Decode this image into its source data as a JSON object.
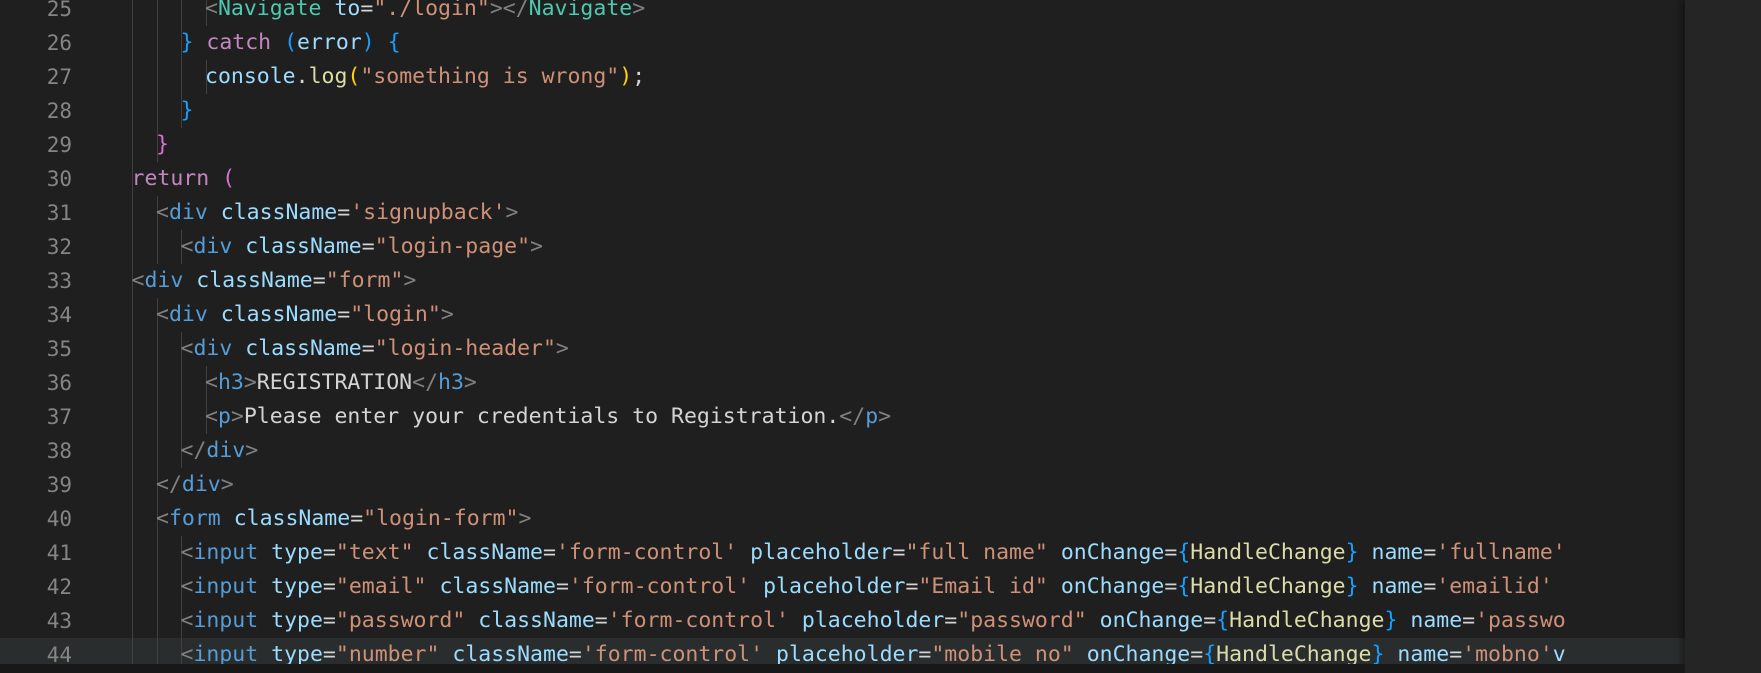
{
  "editor": {
    "lines": [
      {
        "num": "25",
        "indent": 5,
        "tokens": [
          [
            "<",
            "pun"
          ],
          [
            "Navigate",
            "comp"
          ],
          [
            " ",
            "plain"
          ],
          [
            "to",
            "attr"
          ],
          [
            "=",
            "plain"
          ],
          [
            "\"./login\"",
            "str"
          ],
          [
            "></",
            "pun"
          ],
          [
            "Navigate",
            "comp"
          ],
          [
            ">",
            "pun"
          ]
        ]
      },
      {
        "num": "26",
        "indent": 4,
        "tokens": [
          [
            "}",
            "b3"
          ],
          [
            " ",
            "plain"
          ],
          [
            "catch",
            "kw"
          ],
          [
            " ",
            "plain"
          ],
          [
            "(",
            "b3"
          ],
          [
            "error",
            "attr"
          ],
          [
            ")",
            "b3"
          ],
          [
            " ",
            "plain"
          ],
          [
            "{",
            "b3"
          ]
        ]
      },
      {
        "num": "27",
        "indent": 5,
        "tokens": [
          [
            "console",
            "attr"
          ],
          [
            ".",
            "plain"
          ],
          [
            "log",
            "fn"
          ],
          [
            "(",
            "b1"
          ],
          [
            "\"something is wrong\"",
            "str"
          ],
          [
            ")",
            "b1"
          ],
          [
            ";",
            "plain"
          ]
        ]
      },
      {
        "num": "28",
        "indent": 4,
        "tokens": [
          [
            "}",
            "b3"
          ]
        ]
      },
      {
        "num": "29",
        "indent": 3,
        "tokens": [
          [
            "}",
            "b2"
          ]
        ]
      },
      {
        "num": "30",
        "indent": 2,
        "tokens": [
          [
            "return",
            "kw"
          ],
          [
            " ",
            "plain"
          ],
          [
            "(",
            "b2"
          ]
        ]
      },
      {
        "num": "31",
        "indent": 3,
        "tokens": [
          [
            "<",
            "pun"
          ],
          [
            "div",
            "tag"
          ],
          [
            " ",
            "plain"
          ],
          [
            "className",
            "attr"
          ],
          [
            "=",
            "plain"
          ],
          [
            "'signupback'",
            "str"
          ],
          [
            ">",
            "pun"
          ]
        ]
      },
      {
        "num": "32",
        "indent": 4,
        "tokens": [
          [
            "<",
            "pun"
          ],
          [
            "div",
            "tag"
          ],
          [
            " ",
            "plain"
          ],
          [
            "className",
            "attr"
          ],
          [
            "=",
            "plain"
          ],
          [
            "\"login-page\"",
            "str"
          ],
          [
            ">",
            "pun"
          ]
        ]
      },
      {
        "num": "33",
        "indent": 2,
        "tokens": [
          [
            "<",
            "pun"
          ],
          [
            "div",
            "tag"
          ],
          [
            " ",
            "plain"
          ],
          [
            "className",
            "attr"
          ],
          [
            "=",
            "plain"
          ],
          [
            "\"form\"",
            "str"
          ],
          [
            ">",
            "pun"
          ]
        ]
      },
      {
        "num": "34",
        "indent": 3,
        "tokens": [
          [
            "<",
            "pun"
          ],
          [
            "div",
            "tag"
          ],
          [
            " ",
            "plain"
          ],
          [
            "className",
            "attr"
          ],
          [
            "=",
            "plain"
          ],
          [
            "\"login\"",
            "str"
          ],
          [
            ">",
            "pun"
          ]
        ]
      },
      {
        "num": "35",
        "indent": 4,
        "tokens": [
          [
            "<",
            "pun"
          ],
          [
            "div",
            "tag"
          ],
          [
            " ",
            "plain"
          ],
          [
            "className",
            "attr"
          ],
          [
            "=",
            "plain"
          ],
          [
            "\"login-header\"",
            "str"
          ],
          [
            ">",
            "pun"
          ]
        ]
      },
      {
        "num": "36",
        "indent": 5,
        "tokens": [
          [
            "<",
            "pun"
          ],
          [
            "h3",
            "tag"
          ],
          [
            ">",
            "pun"
          ],
          [
            "REGISTRATION",
            "plain"
          ],
          [
            "</",
            "pun"
          ],
          [
            "h3",
            "tag"
          ],
          [
            ">",
            "pun"
          ]
        ]
      },
      {
        "num": "37",
        "indent": 5,
        "tokens": [
          [
            "<",
            "pun"
          ],
          [
            "p",
            "tag"
          ],
          [
            ">",
            "pun"
          ],
          [
            "Please enter your credentials to Registration.",
            "plain"
          ],
          [
            "</",
            "pun"
          ],
          [
            "p",
            "tag"
          ],
          [
            ">",
            "pun"
          ]
        ]
      },
      {
        "num": "38",
        "indent": 4,
        "tokens": [
          [
            "</",
            "pun"
          ],
          [
            "div",
            "tag"
          ],
          [
            ">",
            "pun"
          ]
        ]
      },
      {
        "num": "39",
        "indent": 3,
        "tokens": [
          [
            "</",
            "pun"
          ],
          [
            "div",
            "tag"
          ],
          [
            ">",
            "pun"
          ]
        ]
      },
      {
        "num": "40",
        "indent": 3,
        "tokens": [
          [
            "<",
            "pun"
          ],
          [
            "form",
            "tag"
          ],
          [
            " ",
            "plain"
          ],
          [
            "className",
            "attr"
          ],
          [
            "=",
            "plain"
          ],
          [
            "\"login-form\"",
            "str"
          ],
          [
            ">",
            "pun"
          ]
        ]
      },
      {
        "num": "41",
        "indent": 4,
        "tokens": [
          [
            "<",
            "pun"
          ],
          [
            "input",
            "tag"
          ],
          [
            " ",
            "plain"
          ],
          [
            "type",
            "attr"
          ],
          [
            "=",
            "plain"
          ],
          [
            "\"text\"",
            "str"
          ],
          [
            " ",
            "plain"
          ],
          [
            "className",
            "attr"
          ],
          [
            "=",
            "plain"
          ],
          [
            "'form-control'",
            "str"
          ],
          [
            " ",
            "plain"
          ],
          [
            "placeholder",
            "attr"
          ],
          [
            "=",
            "plain"
          ],
          [
            "\"full name\"",
            "str"
          ],
          [
            " ",
            "plain"
          ],
          [
            "onChange",
            "attr"
          ],
          [
            "=",
            "plain"
          ],
          [
            "{",
            "b3"
          ],
          [
            "HandleChange",
            "fn"
          ],
          [
            "}",
            "b3"
          ],
          [
            " ",
            "plain"
          ],
          [
            "name",
            "attr"
          ],
          [
            "=",
            "plain"
          ],
          [
            "'fullname'",
            "str"
          ]
        ]
      },
      {
        "num": "42",
        "indent": 4,
        "tokens": [
          [
            "<",
            "pun"
          ],
          [
            "input",
            "tag"
          ],
          [
            " ",
            "plain"
          ],
          [
            "type",
            "attr"
          ],
          [
            "=",
            "plain"
          ],
          [
            "\"email\"",
            "str"
          ],
          [
            " ",
            "plain"
          ],
          [
            "className",
            "attr"
          ],
          [
            "=",
            "plain"
          ],
          [
            "'form-control'",
            "str"
          ],
          [
            " ",
            "plain"
          ],
          [
            "placeholder",
            "attr"
          ],
          [
            "=",
            "plain"
          ],
          [
            "\"Email id\"",
            "str"
          ],
          [
            " ",
            "plain"
          ],
          [
            "onChange",
            "attr"
          ],
          [
            "=",
            "plain"
          ],
          [
            "{",
            "b3"
          ],
          [
            "HandleChange",
            "fn"
          ],
          [
            "}",
            "b3"
          ],
          [
            " ",
            "plain"
          ],
          [
            "name",
            "attr"
          ],
          [
            "=",
            "plain"
          ],
          [
            "'emailid'",
            "str"
          ]
        ]
      },
      {
        "num": "43",
        "indent": 4,
        "tokens": [
          [
            "<",
            "pun"
          ],
          [
            "input",
            "tag"
          ],
          [
            " ",
            "plain"
          ],
          [
            "type",
            "attr"
          ],
          [
            "=",
            "plain"
          ],
          [
            "\"password\"",
            "str"
          ],
          [
            " ",
            "plain"
          ],
          [
            "className",
            "attr"
          ],
          [
            "=",
            "plain"
          ],
          [
            "'form-control'",
            "str"
          ],
          [
            " ",
            "plain"
          ],
          [
            "placeholder",
            "attr"
          ],
          [
            "=",
            "plain"
          ],
          [
            "\"password\"",
            "str"
          ],
          [
            " ",
            "plain"
          ],
          [
            "onChange",
            "attr"
          ],
          [
            "=",
            "plain"
          ],
          [
            "{",
            "b3"
          ],
          [
            "HandleChange",
            "fn"
          ],
          [
            "}",
            "b3"
          ],
          [
            " ",
            "plain"
          ],
          [
            "name",
            "attr"
          ],
          [
            "=",
            "plain"
          ],
          [
            "'passwo",
            "str"
          ]
        ]
      },
      {
        "num": "44",
        "indent": 4,
        "current": true,
        "tokens": [
          [
            "<",
            "pun"
          ],
          [
            "input",
            "tag"
          ],
          [
            " ",
            "plain"
          ],
          [
            "type",
            "attr"
          ],
          [
            "=",
            "plain"
          ],
          [
            "\"number\"",
            "str"
          ],
          [
            " ",
            "plain"
          ],
          [
            "className",
            "attr"
          ],
          [
            "=",
            "plain"
          ],
          [
            "'form-control'",
            "str"
          ],
          [
            " ",
            "plain"
          ],
          [
            "placeholder",
            "attr"
          ],
          [
            "=",
            "plain"
          ],
          [
            "\"mobile no\"",
            "str"
          ],
          [
            " ",
            "plain"
          ],
          [
            "onChange",
            "attr"
          ],
          [
            "=",
            "plain"
          ],
          [
            "{",
            "b3"
          ],
          [
            "HandleChange",
            "fn"
          ],
          [
            "}",
            "b3"
          ],
          [
            " ",
            "plain"
          ],
          [
            "name",
            "attr"
          ],
          [
            "=",
            "plain"
          ],
          [
            "'mobno'",
            "str"
          ],
          [
            "v",
            "attr"
          ]
        ]
      }
    ]
  },
  "colors": {
    "background": "#1f1f1f",
    "line_number": "#858585",
    "keyword": "#c586c0",
    "tag": "#569cd6",
    "component": "#4ec9b0",
    "attribute": "#9cdcfe",
    "string": "#ce9178",
    "function": "#dcdcaa"
  }
}
